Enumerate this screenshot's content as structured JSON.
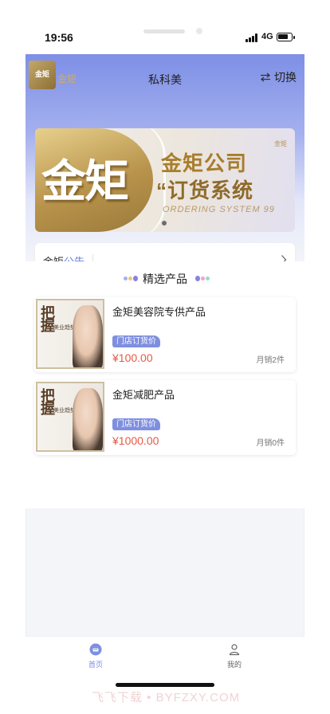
{
  "status_bar": {
    "time": "19:56",
    "network": "4G"
  },
  "header": {
    "logo_text": "金矩",
    "logo_label": "金矩",
    "title": "私科美",
    "switch_label": "切换",
    "switch_icon": "swap-arrows-icon"
  },
  "banner": {
    "big_char": "金矩",
    "line1": "金矩公司",
    "line2": "“订货系统",
    "line3": "ORDERING SYSTEM 99",
    "mini_logo": "金矩",
    "slides": 1,
    "active_slide": 1
  },
  "notice": {
    "label_a": "金矩",
    "label_b": "公告",
    "chevron_icon": "chevron-right-icon"
  },
  "products_section": {
    "title": "精选产品",
    "items": [
      {
        "name": "金矩美容院专供产品",
        "tag": "门店订货价",
        "price": "¥100.00",
        "sales": "月销2件",
        "thumb_title": "把握",
        "thumb_sub": "美业趋势 大风向"
      },
      {
        "name": "金矩减肥产品",
        "tag": "门店订货价",
        "price": "¥1000.00",
        "sales": "月销0件",
        "thumb_title": "把握",
        "thumb_sub": "美业趋势 大风向"
      }
    ]
  },
  "tabbar": {
    "items": [
      {
        "label": "首页",
        "icon": "home-icon",
        "active": true
      },
      {
        "label": "我的",
        "icon": "user-icon",
        "active": false
      }
    ]
  },
  "watermark": "飞飞下载 • BYFZXY.COM",
  "colors": {
    "accent": "#7f8fe0",
    "price": "#e55a44",
    "gold": "#b8934b"
  }
}
